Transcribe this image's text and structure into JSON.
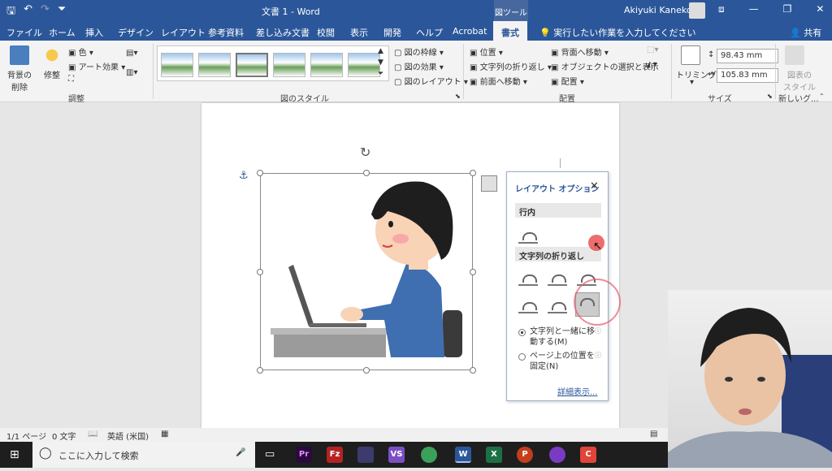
{
  "titlebar": {
    "doc_title": "文書 1  -  Word",
    "tool_context": "図ツール",
    "user_name": "Akiyuki Kaneko",
    "qat": [
      "🖫",
      "↶",
      "↷",
      "⏷"
    ],
    "win": [
      "⧈",
      "—",
      "❐",
      "✕"
    ]
  },
  "tabs": [
    "ファイル",
    "ホーム",
    "挿入",
    "デザイン",
    "レイアウト",
    "参考資料",
    "差し込み文書",
    "校閲",
    "表示",
    "開発",
    "ヘルプ",
    "Acrobat",
    "書式"
  ],
  "tellme": "実行したい作業を入力してください",
  "share": "共有",
  "ribbon": {
    "adjust": {
      "remove_bg": "背景の\n削除",
      "corrections": "修整",
      "color": "色",
      "art_effects": "アート効果",
      "group_label": "調整"
    },
    "styles": {
      "border": "図の枠線",
      "effects": "図の効果",
      "layout": "図のレイアウト",
      "group_label": "図のスタイル"
    },
    "arrange": {
      "position": "位置",
      "wrap_text": "文字列の折り返し",
      "bring_forward": "前面へ移動",
      "send_backward": "背面へ移動",
      "selection_pane": "オブジェクトの選択と表示",
      "align": "配置",
      "group_label": "配置"
    },
    "size": {
      "crop": "トリミング",
      "height": "98.43 mm",
      "width": "105.83 mm",
      "group_label": "サイズ"
    },
    "new_group": {
      "label": "図表の\nスタイル",
      "group_label": "新しいグ..."
    }
  },
  "popup": {
    "title": "レイアウト オプション",
    "section_inline": "行内",
    "section_wrap": "文字列の折り返し",
    "move_with_text": "文字列と一緒に移動する(M)",
    "fix_position": "ページ上の位置を固定(N)",
    "see_more": "詳細表示..."
  },
  "statusbar": {
    "page": "1/1 ページ",
    "words": "0 文字",
    "language": "英語 (米国)"
  },
  "taskbar": {
    "search_placeholder": "ここに入力して検索",
    "icons": [
      "Pr",
      "Fz",
      "",
      "VS",
      "",
      "W",
      "X",
      "P",
      "",
      "C"
    ]
  }
}
